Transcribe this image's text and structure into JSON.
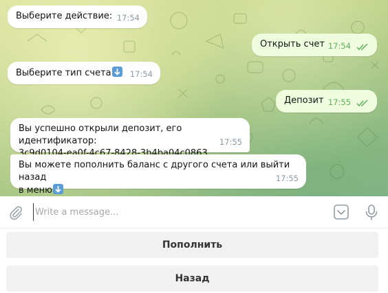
{
  "messages": [
    {
      "text": "Выберите действие:",
      "time": "17:54",
      "direction": "incoming"
    },
    {
      "text": "Открыть счет",
      "time": "17:54",
      "direction": "outgoing"
    },
    {
      "text": "Выберите тип счета",
      "time": "17:54",
      "direction": "incoming",
      "emoji": "down-arrow-emoji"
    },
    {
      "text": "Депозит",
      "time": "17:55",
      "direction": "outgoing"
    },
    {
      "line1": "Вы успешно открыли депозит, его идентификатор:",
      "line2": "3c9d0104-ea0f-4c67-8428-3b4ba04c0863",
      "time": "17:55",
      "direction": "incoming"
    },
    {
      "line1": "Вы можете пополнить баланс с другого счета или выйти назад",
      "line2": "в меню",
      "time": "17:55",
      "direction": "incoming",
      "emoji": "down-arrow-emoji"
    }
  ],
  "composer": {
    "placeholder": "Write a message..."
  },
  "keyboard": {
    "buttons": [
      "Пополнить",
      "Назад"
    ]
  },
  "colors": {
    "incoming_bubble": "#ffffff",
    "outgoing_bubble": "#effdde",
    "read_check": "#5fae5c"
  },
  "icons": [
    "paperclip-icon",
    "keyboard-toggle-icon",
    "microphone-icon",
    "double-check-icon"
  ]
}
